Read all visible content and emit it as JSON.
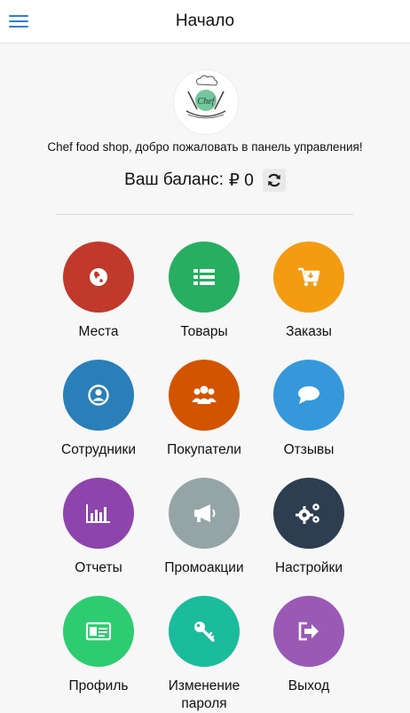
{
  "header": {
    "title": "Начало"
  },
  "welcome_text": "Chef food shop, добро пожаловать в панель управления!",
  "balance": {
    "label": "Ваш баланс:",
    "value": "₽ 0"
  },
  "logo": {
    "text": "Chef"
  },
  "tiles": [
    {
      "label": "Места",
      "color": "#c0392b",
      "icon": "globe-icon"
    },
    {
      "label": "Товары",
      "color": "#27ae60",
      "icon": "list-icon"
    },
    {
      "label": "Заказы",
      "color": "#f39c12",
      "icon": "cart-icon"
    },
    {
      "label": "Сотрудники",
      "color": "#2a7fb8",
      "icon": "user-icon"
    },
    {
      "label": "Покупатели",
      "color": "#d35400",
      "icon": "group-icon"
    },
    {
      "label": "Отзывы",
      "color": "#3498db",
      "icon": "chat-icon"
    },
    {
      "label": "Отчеты",
      "color": "#8e44ad",
      "icon": "bar-chart-icon"
    },
    {
      "label": "Промоакции",
      "color": "#95a5a6",
      "icon": "megaphone-icon"
    },
    {
      "label": "Настройки",
      "color": "#2c3e50",
      "icon": "gears-icon"
    },
    {
      "label": "Профиль",
      "color": "#2ecc71",
      "icon": "id-card-icon"
    },
    {
      "label": "Изменение пароля",
      "color": "#1abc9c",
      "icon": "key-icon"
    },
    {
      "label": "Выход",
      "color": "#9b59b6",
      "icon": "sign-out-icon"
    }
  ]
}
